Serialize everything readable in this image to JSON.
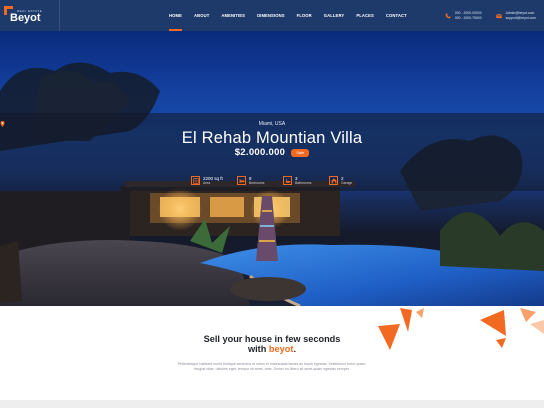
{
  "brand": {
    "name": "Beyot",
    "tagline": "REAL ESTATE"
  },
  "nav": {
    "items": [
      {
        "label": "HOME",
        "active": true
      },
      {
        "label": "ABOUT"
      },
      {
        "label": "AMENITIES"
      },
      {
        "label": "DIMENSIONS"
      },
      {
        "label": "FLOOR"
      },
      {
        "label": "GALLERY"
      },
      {
        "label": "PLACES"
      },
      {
        "label": "CONTACT"
      }
    ]
  },
  "contact": {
    "phone_icon": "phone-icon",
    "phones": [
      "000 - 2000-00000",
      "000 - 2000-75000"
    ],
    "mail_icon": "mail-icon",
    "emails": [
      "Admin@beyot.com",
      "support@beyot.com"
    ]
  },
  "hero": {
    "location": "Miami, USA",
    "title": "El Rehab Mountian Villa",
    "price": "$2.000.000",
    "badge": "Sale",
    "features": [
      {
        "icon": "area-icon",
        "value": "2200 sq ft",
        "label": "Area"
      },
      {
        "icon": "bedroom-icon",
        "value": "8",
        "label": "Bedrooms"
      },
      {
        "icon": "bathroom-icon",
        "value": "3",
        "label": "Bathrooms"
      },
      {
        "icon": "garage-icon",
        "value": "2",
        "label": "Garage"
      }
    ]
  },
  "sell": {
    "line1": "Sell your house in few seconds",
    "line2_prefix": "with ",
    "line2_accent": "beyot",
    "line2_suffix": ".",
    "description": "Pellentesque habitant morbi tristique senectus et netus et malesuada fames ac turpis egestas. Vestibulum tortor quam, feugiat vitae, ultricies eget, tempor sit amet, ante. Donec eu libero sit amet quam egestas semper."
  },
  "colors": {
    "accent": "#f26a21",
    "header_bg": "#1d3a6b",
    "text_dark": "#22252b"
  }
}
